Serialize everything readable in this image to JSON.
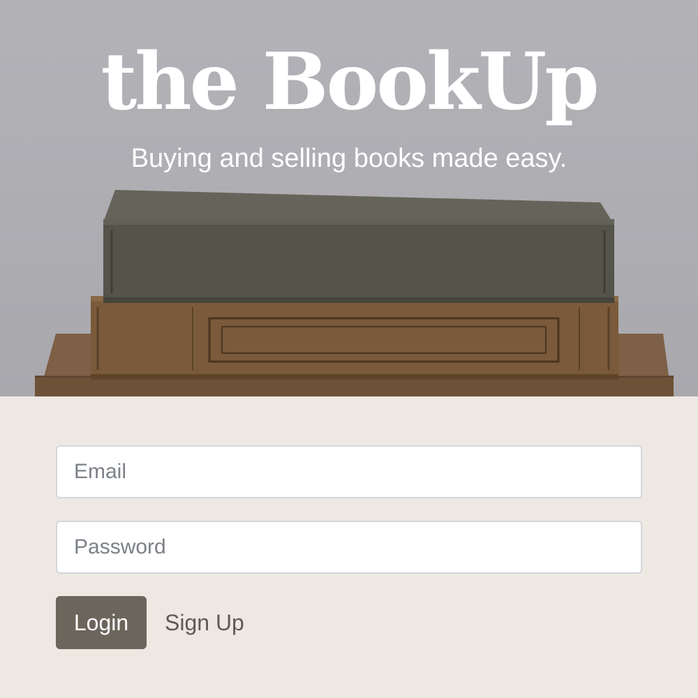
{
  "hero": {
    "brand": "the BookUp",
    "tagline": "Buying and selling books made easy."
  },
  "login_form": {
    "email_placeholder": "Email",
    "password_placeholder": "Password",
    "login_label": "Login",
    "signup_label": "Sign Up"
  },
  "colors": {
    "page_background": "#ede8e2",
    "button_background": "#6b655b",
    "text_on_hero": "#ffffff"
  }
}
